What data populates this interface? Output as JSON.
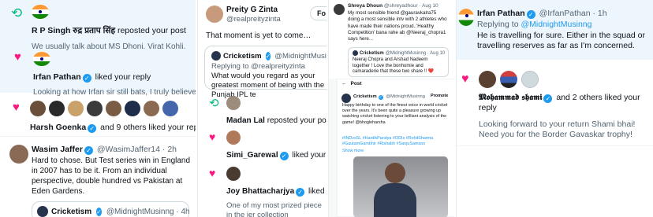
{
  "p1": {
    "n1_actor": "R P Singh रुद्र प्रताप सिंह",
    "n1_action": "reposted your post",
    "n1_snippet": "We usually talk about MS Dhoni. Virat Kohli.",
    "n2_actor": "Irfan Pathan",
    "n2_action": "liked your reply",
    "n2_snippet": "Looking at how Irfan sir still bats, I truly believe",
    "n3_actor": "Harsh Goenka",
    "n3_action": "and 9 others liked your reply",
    "t_name": "Wasim Jaffer",
    "t_handle": "@WasimJaffer14 · 2h",
    "t_text": "Hard to chose. But Test series win in England in 2007 has to be it. From an individual perspective, double hundred vs Pakistan at Eden Gardens.",
    "q_name": "Cricketism",
    "q_handle": "@MidnightMusinng · 4h"
  },
  "p2": {
    "name": "Preity G Zinta",
    "handle": "@realpreityzinta",
    "follow": "Fo",
    "text": "That moment is yet to come…",
    "q_name": "Cricketism",
    "q_handle": "@MidnightMusinng",
    "q_reply": "Replying to @realpreityzinta",
    "q_text": "What would you regard as your greatest moment of being with the Punjab IPL te",
    "n1_actor": "Madan Lal",
    "n1_action": "reposted your post",
    "n2_actor": "Simi_Garewal",
    "n2_action": "liked your reply",
    "n3_actor": "Joy Bhattacharjya",
    "n3_action": "liked your reply",
    "n3_snippet": "One of my most prized piece in the jer collection"
  },
  "p3": {
    "name": "Shreya Dhoun",
    "handle": "@shreyadhour · Aug 10",
    "text": "My most sensible friend @gauravkalra75 doing a most sensible intv with 2 athletes who have made their nations proud..'Healthy Competition' bana rahe ab @Neeraj_chopra1 says here...",
    "q_name": "Cricketism",
    "q_handle": "@MidnightMusinng · Aug 10",
    "q_text": "Neeraj Chopra and Arshad Nadeem together ! Love the bonhomie and camaraderie that these two share !! ❤️",
    "post_label": "Post",
    "p_name": "Cricketism",
    "p_handle": "@MidnightMusinng",
    "promote": "Promote",
    "p_text": "Happy birthday to one of the finest voice in world cricket over the years. It's been quite a pleasure growing up watching cricket listening to your brilliant analysis of the game! @bhogleharsha",
    "p_tags": "#INDvsSL #HardikPandya #ODIs #RohitSharma #GautamGambhir #Rishabh #SanjuSamson",
    "show_more": "Show more"
  },
  "p4": {
    "name": "Irfan Pathan",
    "handle": "@IrfanPathan · 1h",
    "reply_prefix": "Replying to",
    "reply_handle": "@MidnightMusinng",
    "text": "He is travelling for sure. Either in the squad or travelling reserves as far as I'm concerned.",
    "n_actor": "𝕸𝖔𝖍𝖆𝖒𝖒𝖆𝖉 𝖘𝖍𝖆𝖒𝖎",
    "n_action": "and 2 others liked your reply",
    "n_snippet": "Looking forward to your return Shami bhai! Need you for the Border Gavaskar trophy!"
  },
  "colors": {
    "blue": "#1d9bf0",
    "pink": "#f91880",
    "green": "#00ba7c",
    "muted": "#536471"
  }
}
